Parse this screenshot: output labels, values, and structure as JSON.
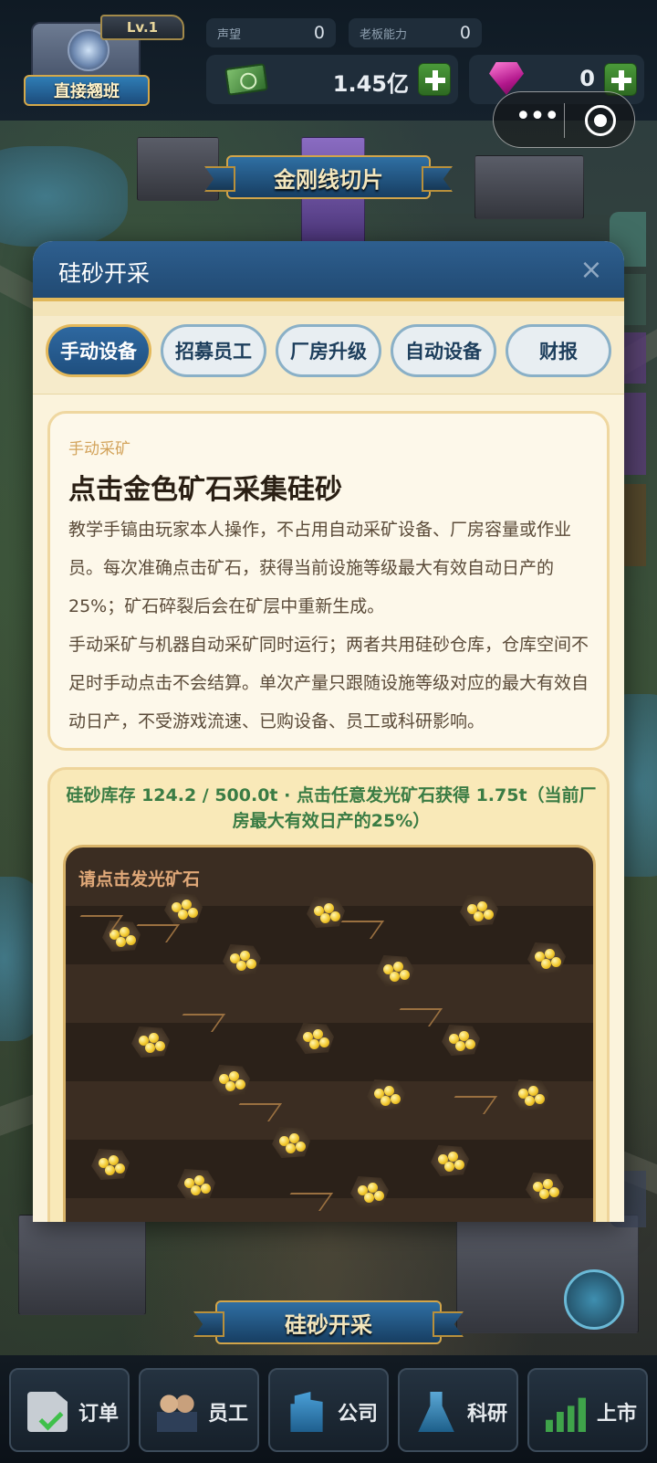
{
  "top_bar": {
    "level": "Lv.1",
    "factory_name": "直接翘班",
    "reputation": {
      "label": "声望",
      "value": "0"
    },
    "boss_ability": {
      "label": "老板能力",
      "value": "0"
    },
    "money": {
      "value": "1.45亿",
      "icon": "cash-icon"
    },
    "gems": {
      "value": "0",
      "icon": "gem-icon"
    }
  },
  "scene": {
    "top_banner": "金刚线切片",
    "bottom_banner": "硅砂开采"
  },
  "dialog": {
    "title": "硅砂开采",
    "close_symbol": "×",
    "tabs": [
      {
        "label": "手动设备",
        "active": true
      },
      {
        "label": "招募员工",
        "active": false
      },
      {
        "label": "厂房升级",
        "active": false
      },
      {
        "label": "自动设备",
        "active": false
      },
      {
        "label": "财报",
        "active": false
      }
    ],
    "info": {
      "kicker": "手动采矿",
      "heading": "点击金色矿石采集硅砂",
      "paragraph_1": "教学手镐由玩家本人操作，不占用自动采矿设备、厂房容量或作业员。每次准确点击矿石，获得当前设施等级最大有效自动日产的25%；矿石碎裂后会在矿层中重新生成。",
      "paragraph_2": "手动采矿与机器自动采矿同时运行；两者共用硅砂仓库，仓库空间不足时手动点击不会结算。单次产量只跟随设施等级对应的最大有效自动日产，不受游戏流速、已购设备、员工或科研影响。"
    },
    "mine": {
      "status": "硅砂库存 124.2 / 500.0t · 点击任意发光矿石获得 1.75t（当前厂房最大有效日产的25%）",
      "hint": "请点击发光矿石"
    }
  },
  "bottom_nav": [
    {
      "label": "订单",
      "icon": "order-document-icon"
    },
    {
      "label": "员工",
      "icon": "staff-icon"
    },
    {
      "label": "公司",
      "icon": "company-building-icon"
    },
    {
      "label": "科研",
      "icon": "research-flask-icon"
    },
    {
      "label": "上市",
      "icon": "stock-chart-icon"
    }
  ]
}
